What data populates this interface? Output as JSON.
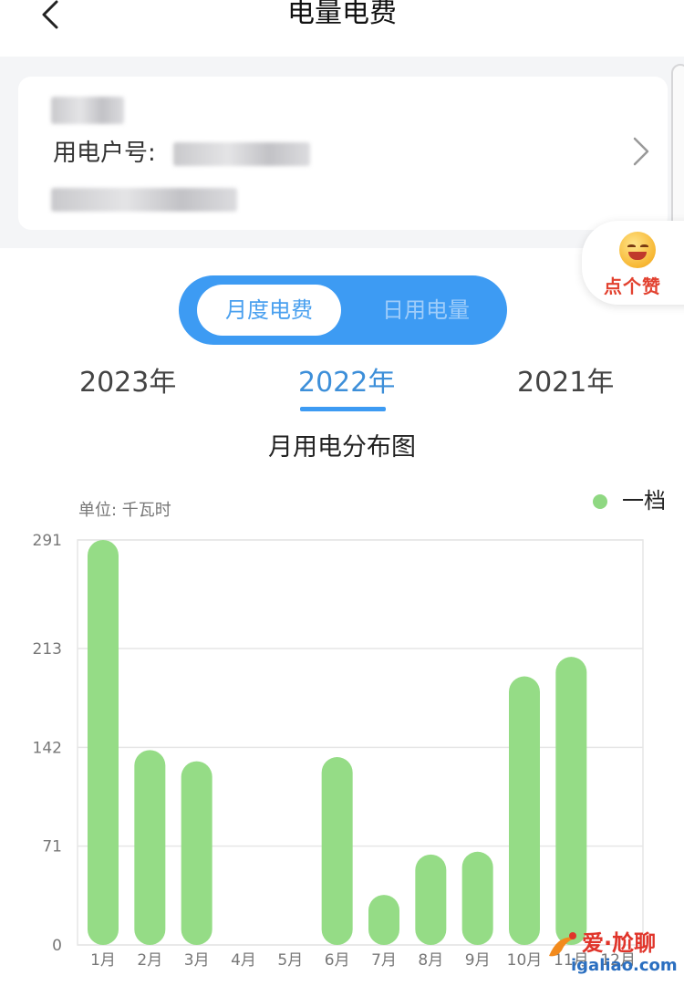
{
  "header": {
    "title": "电量电费"
  },
  "account": {
    "label": "用电户号:"
  },
  "like_badge": {
    "text": "点个赞"
  },
  "toggle": {
    "active_label": "月度电费",
    "inactive_label": "日用电量"
  },
  "years": [
    {
      "label": "2023年",
      "active": false
    },
    {
      "label": "2022年",
      "active": true
    },
    {
      "label": "2021年",
      "active": false
    }
  ],
  "watermark": {
    "title": "爱·尬聊",
    "url": "igaliao.com"
  },
  "colors": {
    "accent": "#3d9bf3",
    "bar": "#95dc86",
    "grid": "#e6e6e6"
  },
  "chart_data": {
    "type": "bar",
    "title": "月用电分布图",
    "unit_label": "单位: 千瓦时",
    "categories": [
      "1月",
      "2月",
      "3月",
      "4月",
      "5月",
      "6月",
      "7月",
      "8月",
      "9月",
      "10月",
      "11月",
      "12月"
    ],
    "series": [
      {
        "name": "一档",
        "values": [
          291,
          140,
          132,
          0,
          0,
          135,
          36,
          65,
          67,
          193,
          207,
          0
        ]
      }
    ],
    "yticks": [
      "291",
      "213",
      "142",
      "71",
      "0"
    ],
    "ylim": [
      0,
      291
    ],
    "grid": true,
    "legend": "top-right"
  }
}
